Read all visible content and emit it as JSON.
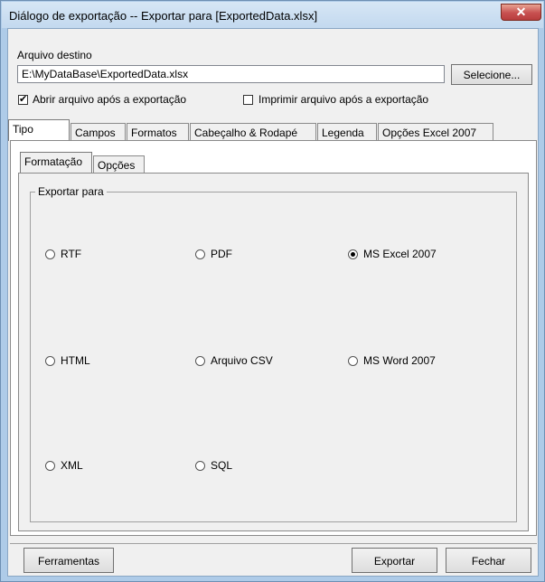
{
  "window": {
    "title": "Diálogo de exportação -- Exportar para [ExportedData.xlsx]",
    "close_symbol": "✕"
  },
  "destination": {
    "label": "Arquivo destino",
    "path": "E:\\MyDataBase\\ExportedData.xlsx",
    "select_label": "Selecione..."
  },
  "options": {
    "open_after_label": "Abrir arquivo após a exportação",
    "open_after_checked": true,
    "print_after_label": "Imprimir arquivo após a exportação",
    "print_after_checked": false
  },
  "tabs": [
    {
      "label": "Tipo",
      "active": true
    },
    {
      "label": "Campos",
      "active": false
    },
    {
      "label": "Formatos",
      "active": false
    },
    {
      "label": "Cabeçalho & Rodapé",
      "active": false
    },
    {
      "label": "Legenda",
      "active": false
    },
    {
      "label": "Opções Excel 2007",
      "active": false
    }
  ],
  "subtabs": [
    {
      "label": "Formatação",
      "active": true
    },
    {
      "label": "Opções",
      "active": false
    }
  ],
  "export_to": {
    "group_label": "Exportar para",
    "formats": [
      {
        "label": "RTF",
        "selected": false
      },
      {
        "label": "PDF",
        "selected": false
      },
      {
        "label": "MS Excel 2007",
        "selected": true
      },
      {
        "label": "HTML",
        "selected": false
      },
      {
        "label": "Arquivo CSV",
        "selected": false
      },
      {
        "label": "MS Word 2007",
        "selected": false
      },
      {
        "label": "XML",
        "selected": false
      },
      {
        "label": "SQL",
        "selected": false
      }
    ]
  },
  "footer": {
    "tools_label": "Ferramentas",
    "export_label": "Exportar",
    "close_label": "Fechar"
  },
  "icons": {
    "checkmark": "✔"
  }
}
